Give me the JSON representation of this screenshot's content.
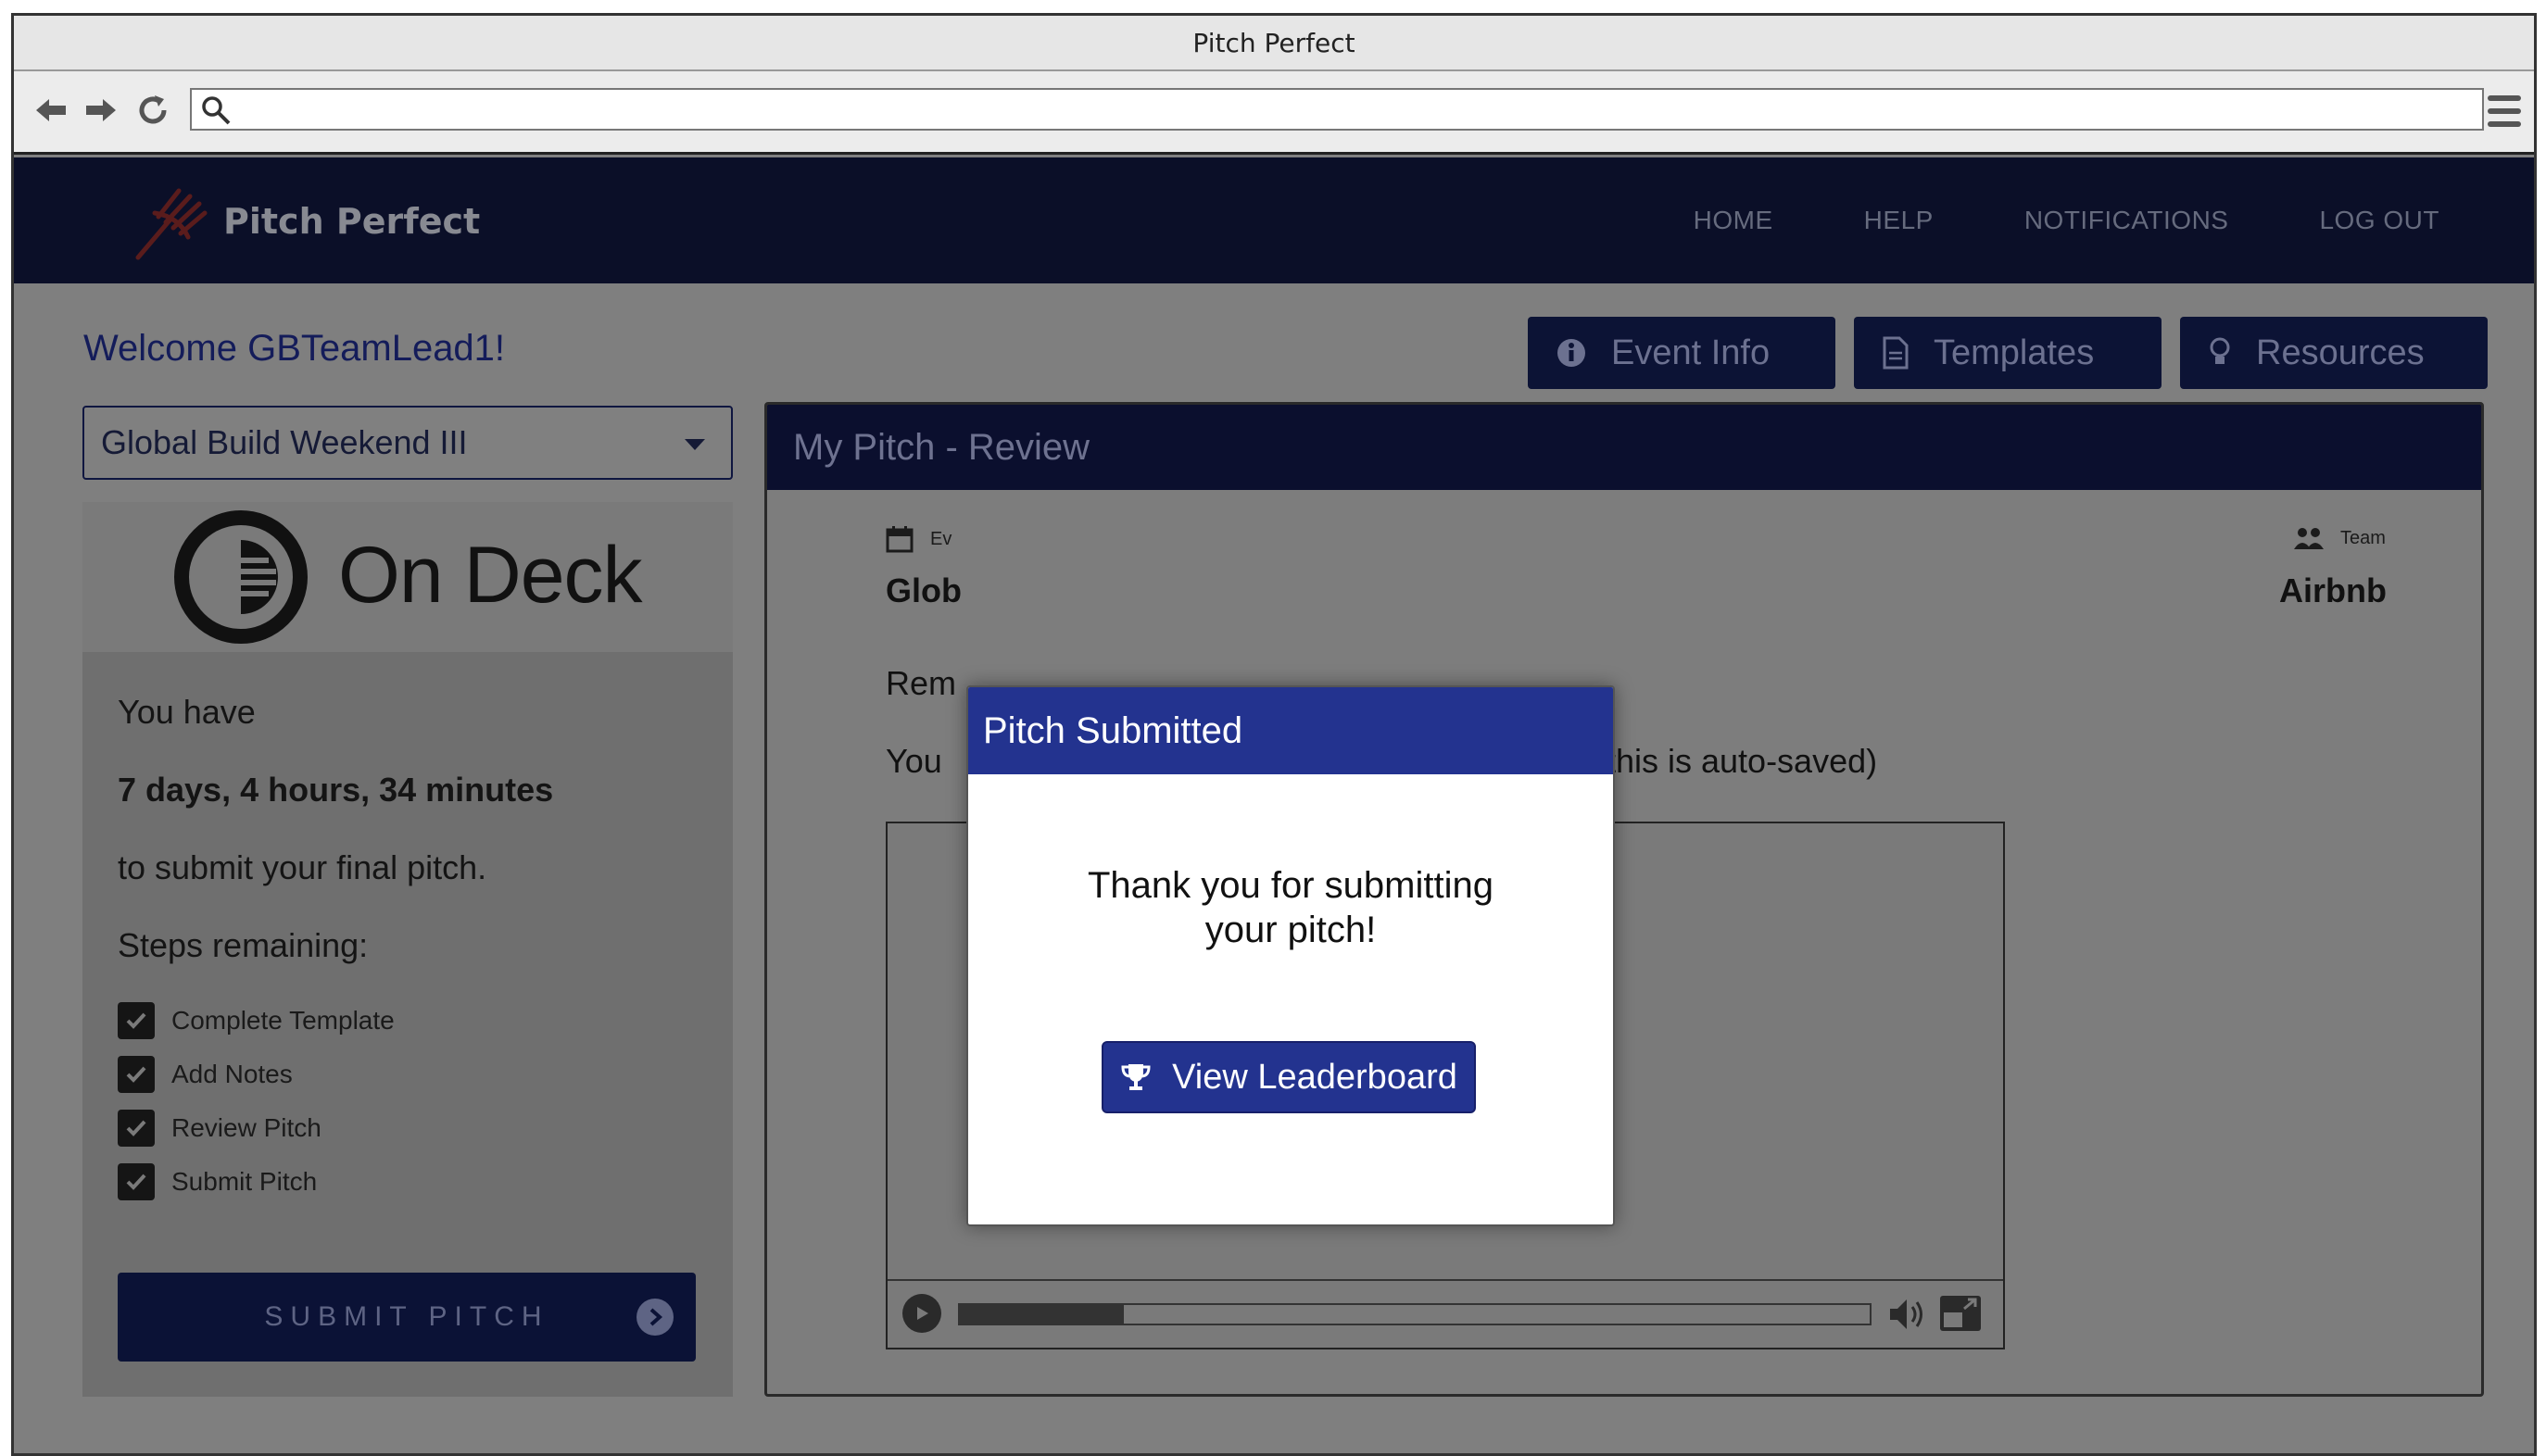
{
  "browser": {
    "window_title": "Pitch Perfect",
    "url": ""
  },
  "app": {
    "brand": "Pitch Perfect",
    "nav": [
      "HOME",
      "HELP",
      "NOTIFICATIONS",
      "LOG OUT"
    ],
    "welcome": "Welcome GBTeamLead1!",
    "top_buttons": [
      {
        "label": "Event Info",
        "icon": "info-icon"
      },
      {
        "label": "Templates",
        "icon": "document-icon"
      },
      {
        "label": "Resources",
        "icon": "lightbulb-icon"
      }
    ]
  },
  "sidebar": {
    "event_select": "Global Build Weekend III",
    "ondeck_title": "On Deck",
    "you_have": "You have",
    "countdown": "7 days,  4 hours,  34 minutes",
    "submit_note": "to submit your final pitch.",
    "steps_heading": "Steps remaining:",
    "steps": [
      {
        "label": "Complete Template",
        "checked": true
      },
      {
        "label": "Add Notes",
        "checked": true
      },
      {
        "label": "Review Pitch",
        "checked": true
      },
      {
        "label": "Submit Pitch",
        "checked": true
      }
    ],
    "submit_button": "SUBMIT PITCH"
  },
  "pitch": {
    "header": "My Pitch - Review",
    "event_label": "Ev",
    "event_value": "Glob",
    "team_label": "Team",
    "team_value": "Airbnb",
    "line1": "Rem",
    "line2_start": "You",
    "line2_end": "r (this is auto-saved)",
    "video_progress": 0.18
  },
  "modal": {
    "title": "Pitch Submitted",
    "message_line1": "Thank you for submitting",
    "message_line2": "your pitch!",
    "button": "View Leaderboard"
  },
  "colors": {
    "navy": "#0b0f28",
    "modal_blue": "#23338f",
    "overlay_gray": "#7f7f7f"
  }
}
